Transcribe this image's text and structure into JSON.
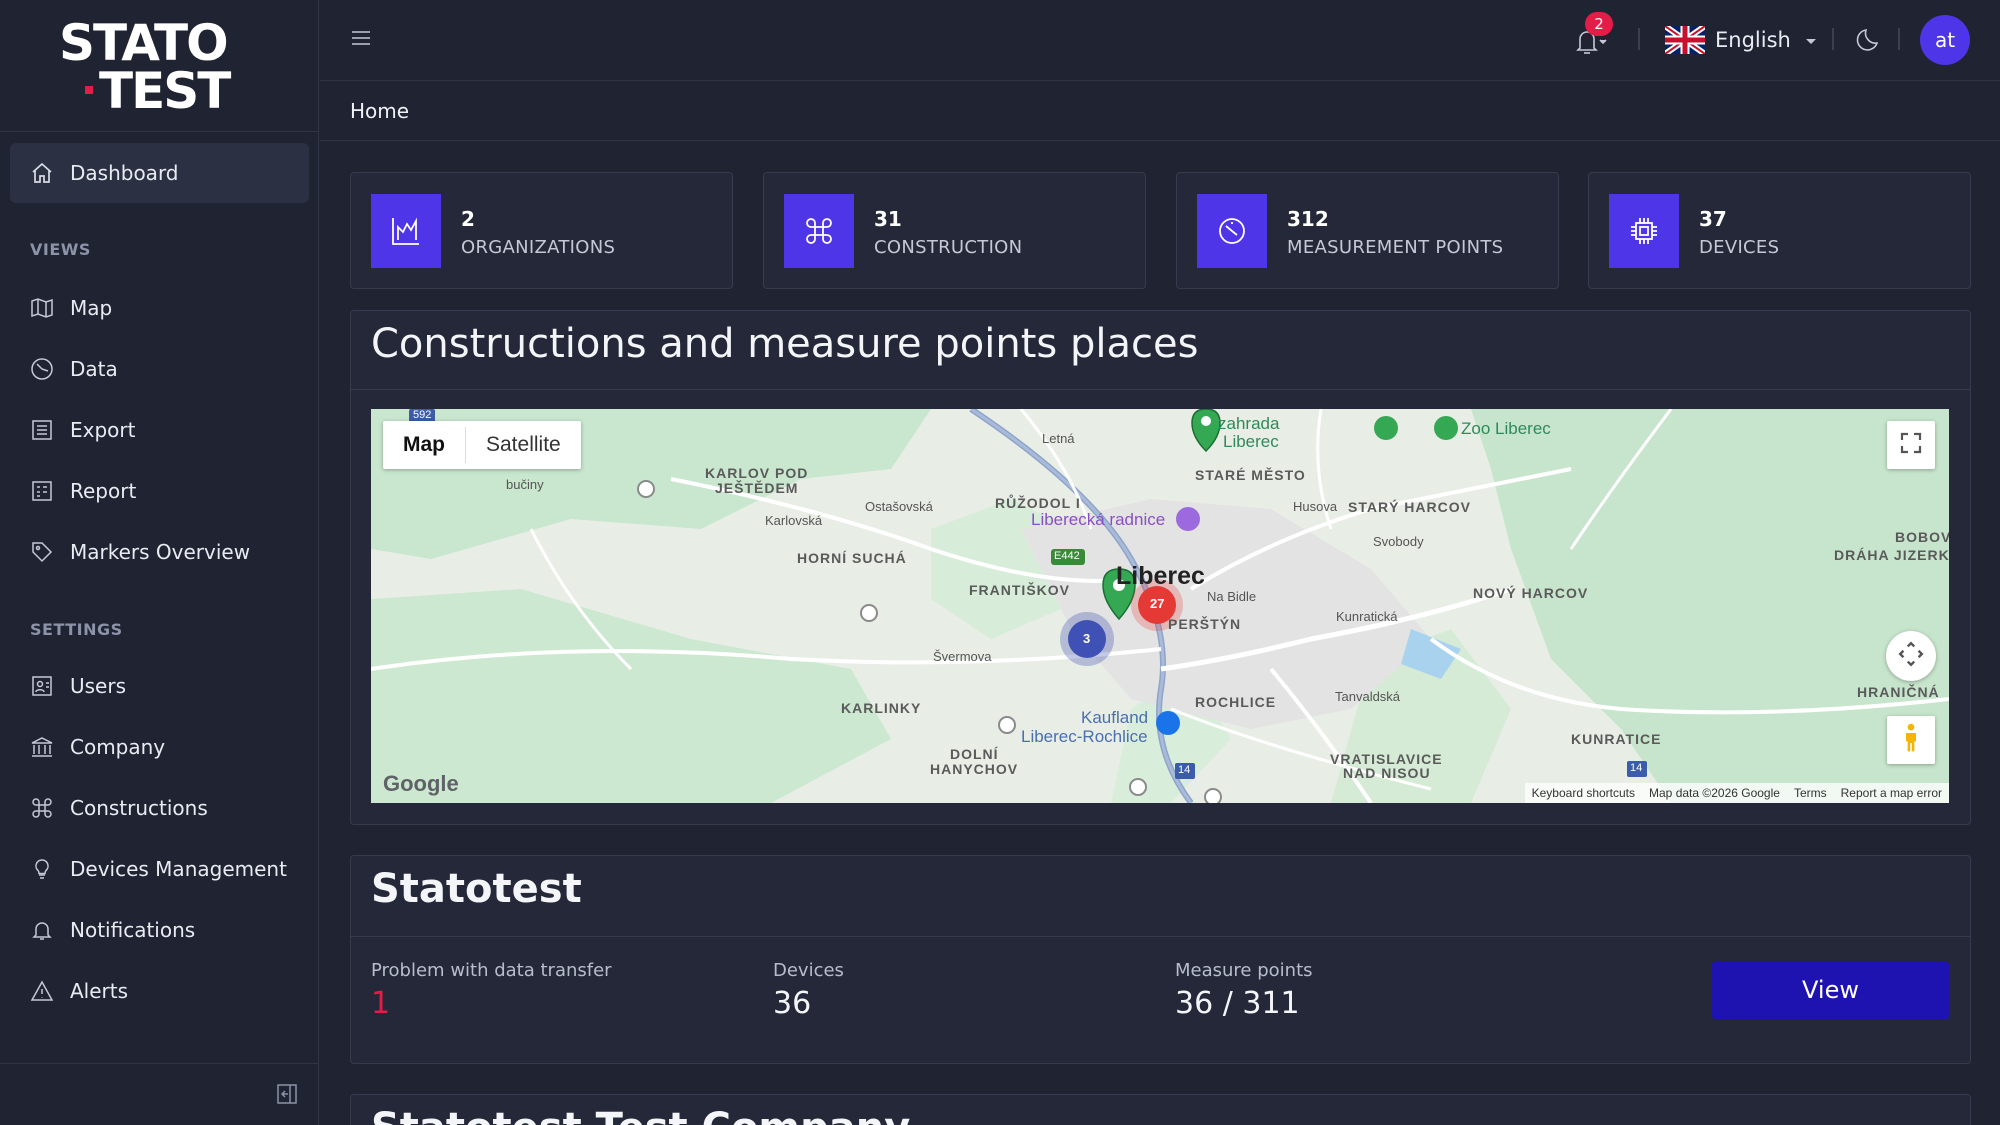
{
  "brand": {
    "line1": "STATO",
    "line2": "TEST"
  },
  "sidebar": {
    "dashboard": "Dashboard",
    "views_title": "VIEWS",
    "views": [
      {
        "label": "Map",
        "icon": "map-icon"
      },
      {
        "label": "Data",
        "icon": "chart-icon"
      },
      {
        "label": "Export",
        "icon": "export-icon"
      },
      {
        "label": "Report",
        "icon": "report-icon"
      },
      {
        "label": "Markers Overview",
        "icon": "tag-icon"
      }
    ],
    "settings_title": "SETTINGS",
    "settings": [
      {
        "label": "Users",
        "icon": "users-icon"
      },
      {
        "label": "Company",
        "icon": "building-icon"
      },
      {
        "label": "Constructions",
        "icon": "command-icon"
      },
      {
        "label": "Devices Management",
        "icon": "bulb-icon"
      },
      {
        "label": "Notifications",
        "icon": "bell-icon"
      },
      {
        "label": "Alerts",
        "icon": "alert-icon"
      }
    ]
  },
  "header": {
    "notification_count": "2",
    "language": "English",
    "avatar_initials": "at"
  },
  "breadcrumb": {
    "current": "Home"
  },
  "stats": [
    {
      "value": "2",
      "label": "ORGANIZATIONS"
    },
    {
      "value": "31",
      "label": "CONSTRUCTION"
    },
    {
      "value": "312",
      "label": "MEASUREMENT POINTS"
    },
    {
      "value": "37",
      "label": "DEVICES"
    }
  ],
  "map_panel": {
    "title": "Constructions and measure points places",
    "toggle_map": "Map",
    "toggle_satellite": "Satellite",
    "google": "Google",
    "footer": [
      "Keyboard shortcuts",
      "Map data ©2026 Google",
      "Terms",
      "Report a map error"
    ],
    "cluster_red": "27",
    "cluster_blue": "3",
    "labels": {
      "liberec": "Liberec",
      "zoo": "Zoo Liberec",
      "zahrada": "zahrada",
      "zahrada2": "Liberec",
      "stare_mesto": "STARÉ MĚSTO",
      "karlov": "KARLOV POD",
      "jestedem": "JEŠTĚDEM",
      "ruzodol": "RŮŽODOL I",
      "radnice": "Liberecká radnice",
      "stary_harcov": "STARÝ HARCOV",
      "horni_sucha": "HORNÍ SUCHÁ",
      "frantiskov": "FRANTIŠKOV",
      "perstyn": "PERŠTÝN",
      "novy_harcov": "NOVÝ HARCOV",
      "bobov1": "BOBOV",
      "bobov2": "DRÁHA JIZERK",
      "rochlice": "ROCHLICE",
      "karlinky": "KARLINKY",
      "kaufland1": "Kaufland",
      "kaufland2": "Liberec-Rochlice",
      "dolni1": "DOLNÍ",
      "dolni2": "HANYCHOV",
      "vratislavice1": "VRATISLAVICE",
      "vratislavice2": "NAD NISOU",
      "kunratice": "KUNRATICE",
      "hranicna": "HRANIČNÁ",
      "buciny": "bučiny",
      "svermova": "Švermova",
      "husova": "Husova",
      "na_bidle": "Na Bidle",
      "kunraticka": "Kunratická",
      "tanvaldska": "Tanvaldská",
      "karlovska": "Karlovská",
      "ostasovska": "Ostašovská",
      "letna": "Letná",
      "svobody": "Svobody",
      "road_e442": "E442",
      "road_592": "592",
      "road_14a": "14",
      "road_14b": "14"
    }
  },
  "companies": [
    {
      "name": "Statotest",
      "problem_label": "Problem with data transfer",
      "problem_value": "1",
      "devices_label": "Devices",
      "devices_value": "36",
      "points_label": "Measure points",
      "points_value": "36 / 311",
      "button": "View"
    },
    {
      "name": "Statotest Test Company"
    }
  ],
  "colors": {
    "accent": "#4f35e8",
    "danger": "#e11d48",
    "button": "#1e12b0",
    "background": "#1f2332",
    "card": "#242838"
  }
}
